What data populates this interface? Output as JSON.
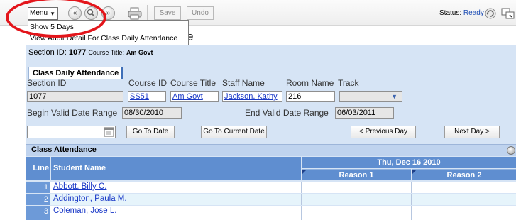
{
  "toolbar": {
    "menu_label": "Menu",
    "save_label": "Save",
    "undo_label": "Undo",
    "status_label": "Status:",
    "status_value": "Ready"
  },
  "menu_dropdown": {
    "items": [
      "Show 5 Days",
      "View Audit Detail For Class Daily Attendance"
    ]
  },
  "page": {
    "title_suffix": "e"
  },
  "section": {
    "id_label": "Section ID:",
    "id_value": "1077",
    "course_title_label": "Course Title:",
    "course_title_value": "Am Govt"
  },
  "tab": {
    "label": "Class Daily Attendance"
  },
  "fields": {
    "section_id_label": "Section ID",
    "section_id_value": "1077",
    "course_id_label": "Course ID",
    "course_id_value": "SS51",
    "course_title_label": "Course Title",
    "course_title_value": "Am Govt",
    "staff_name_label": "Staff Name",
    "staff_name_value": "Jackson, Kathy",
    "room_name_label": "Room Name",
    "room_name_value": "216",
    "track_label": "Track",
    "track_value": "",
    "begin_label": "Begin Valid Date Range",
    "begin_value": "08/30/2010",
    "end_label": "End Valid Date Range",
    "end_value": "06/03/2011",
    "date_input_value": ""
  },
  "buttons": {
    "go_to_date": "Go To Date",
    "go_to_current": "Go To Current Date",
    "previous_day": "< Previous Day",
    "next_day": "Next Day >"
  },
  "grid": {
    "title": "Class Attendance",
    "col_line": "Line",
    "col_student": "Student Name",
    "date_header": "Thu, Dec 16 2010",
    "reason1": "Reason 1",
    "reason2": "Reason 2",
    "rows": [
      {
        "line": "1",
        "name": "Abbott, Billy C."
      },
      {
        "line": "2",
        "name": "Addington, Paula M."
      },
      {
        "line": "3",
        "name": "Coleman, Jose L."
      }
    ]
  },
  "colors": {
    "accent": "#5f8ed0",
    "panel": "#d6e4f5",
    "link": "#1a39c7",
    "highlight": "#e3151b"
  }
}
